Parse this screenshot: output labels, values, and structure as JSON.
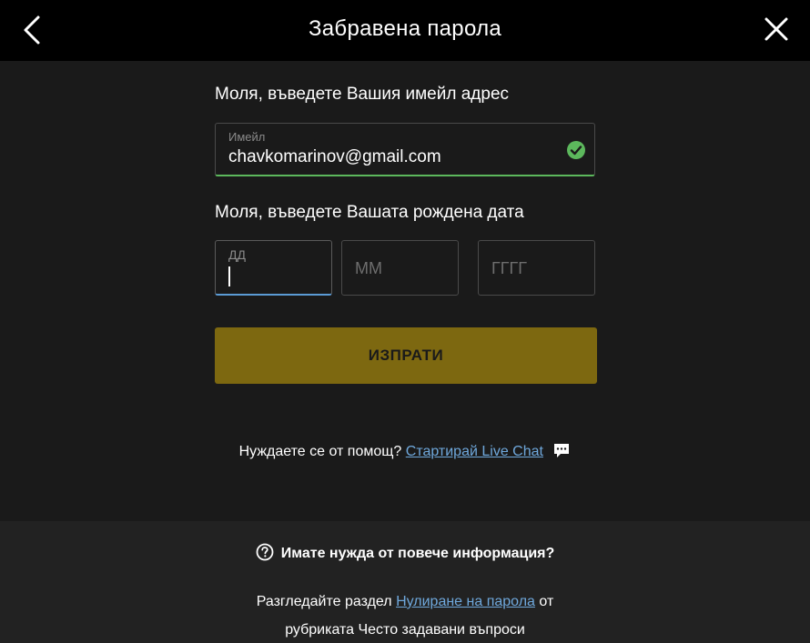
{
  "header": {
    "title": "Забравена парола",
    "back_icon": "chevron-left-icon",
    "close_icon": "close-icon"
  },
  "form": {
    "email_prompt": "Моля, въведете Вашия имейл адрес",
    "email": {
      "label": "Имейл",
      "value": "chavkomarinov@gmail.com",
      "status_icon": "check-circle-icon",
      "status_color": "#5cb85c"
    },
    "dob_prompt": "Моля, въведете Вашата рождена дата",
    "dob": {
      "day_label": "ДД",
      "day_value": "",
      "month_placeholder": "ММ",
      "year_placeholder": "ГГГГ",
      "active_color": "#5b9bd5"
    },
    "submit_label": "ИЗПРАТИ",
    "submit_color": "#7d6810"
  },
  "help": {
    "text": "Нуждаете се от помощ?",
    "link_text": "Стартирай Live Chat",
    "chat_icon": "chat-bubble-icon",
    "link_color": "#6fa8dc"
  },
  "footer": {
    "info_icon": "question-circle-icon",
    "info_heading": "Имате нужда от повече информация?",
    "faq_prefix": "Разгледайте раздел",
    "faq_link": "Нулиране на парола",
    "faq_suffix": "от",
    "faq_line2": "рубриката Често задавани въпроси"
  }
}
